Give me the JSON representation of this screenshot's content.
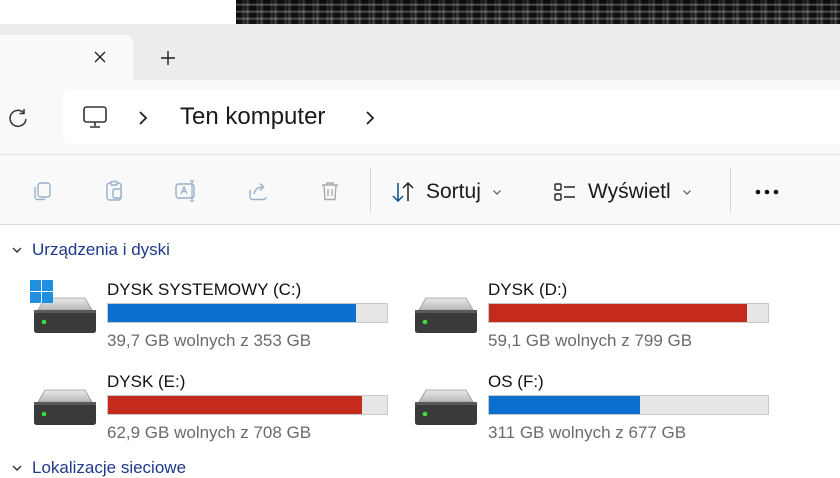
{
  "tabs": {
    "close_glyph": "✕",
    "new_tab_glyph": "+"
  },
  "address": {
    "breadcrumb": "Ten komputer"
  },
  "toolbar": {
    "icons": [
      "copy-icon",
      "paste-icon",
      "rename-icon",
      "share-icon",
      "delete-icon"
    ],
    "sort_label": "Sortuj",
    "view_label": "Wyświetl",
    "more_glyph": "•••"
  },
  "groups": {
    "devices_label": "Urządzenia i dyski",
    "network_label": "Lokalizacje sieciowe"
  },
  "drives": [
    {
      "name": "DYSK SYSTEMOWY (C:)",
      "free": "39,7 GB wolnych z 353 GB",
      "used_fraction": 0.888,
      "color": "#0a6fcf",
      "windows_logo": true
    },
    {
      "name": "DYSK (D:)",
      "free": "59,1 GB wolnych z 799 GB",
      "used_fraction": 0.926,
      "color": "#c42b1c",
      "windows_logo": false
    },
    {
      "name": "DYSK (E:)",
      "free": "62,9 GB wolnych z 708 GB",
      "used_fraction": 0.911,
      "color": "#c42b1c",
      "windows_logo": false
    },
    {
      "name": "OS (F:)",
      "free": "311 GB wolnych z 677 GB",
      "used_fraction": 0.541,
      "color": "#0a6fcf",
      "windows_logo": false
    }
  ],
  "colors": {
    "accent_blue": "#0a6fcf",
    "warning_red": "#c42b1c",
    "group_header": "#1f3a8a"
  }
}
